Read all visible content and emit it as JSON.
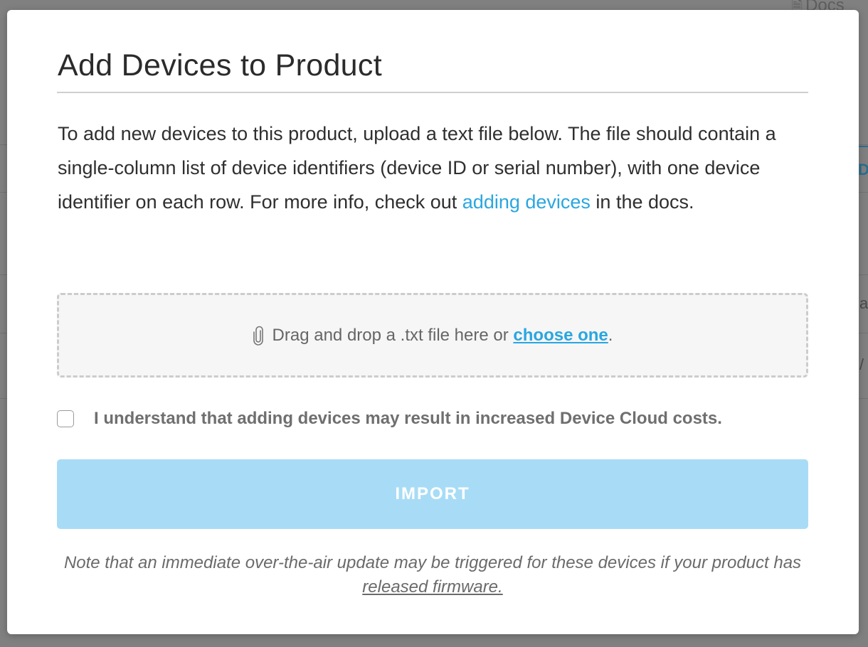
{
  "background": {
    "docs_label": "Docs",
    "fragments": [
      "D",
      "a",
      "/"
    ]
  },
  "modal": {
    "title": "Add Devices to Product",
    "description": {
      "before_link": "To add new devices to this product, upload a text file below. The file should contain a single-column list of device identifiers (device ID or serial number), with one device identifier on each row. For more info, check out ",
      "link_text": "adding devices",
      "after_link": " in the docs."
    },
    "dropzone": {
      "icon": "paperclip-icon",
      "text": "Drag and drop a .txt file here or ",
      "link_text": "choose one",
      "trailing": "."
    },
    "consent": {
      "checked": false,
      "label": "I understand that adding devices may result in increased Device Cloud costs."
    },
    "import_button": {
      "label": "IMPORT",
      "enabled": false
    },
    "note": {
      "text": "Note that an immediate over-the-air update may be triggered for these devices if your product has ",
      "link_text": "released firmware."
    }
  },
  "colors": {
    "accent": "#2aa6e0",
    "button_disabled": "#a8dcf6",
    "overlay": "#808080"
  }
}
